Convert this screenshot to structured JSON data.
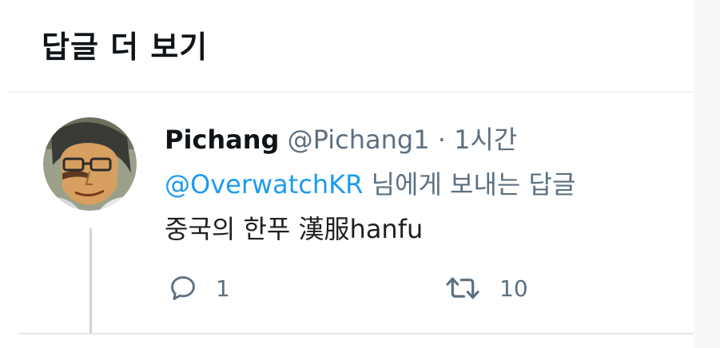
{
  "header": {
    "title": "답글 더 보기"
  },
  "tweet": {
    "author": {
      "name": "Pichang",
      "handle": "@Pichang1"
    },
    "separator": "·",
    "time": "1시간",
    "reply_to": {
      "mention": "@OverwatchKR",
      "suffix": "님에게 보내는 답글"
    },
    "text": "중국의 한푸 漢服hanfu",
    "actions": {
      "reply": {
        "icon": "reply-icon",
        "count": "1"
      },
      "retweet": {
        "icon": "retweet-icon",
        "count": "10"
      }
    }
  },
  "colors": {
    "text_primary": "#0f1419",
    "text_secondary": "#5b7083",
    "link": "#1d9bf0",
    "divider": "#e8e8e8"
  }
}
